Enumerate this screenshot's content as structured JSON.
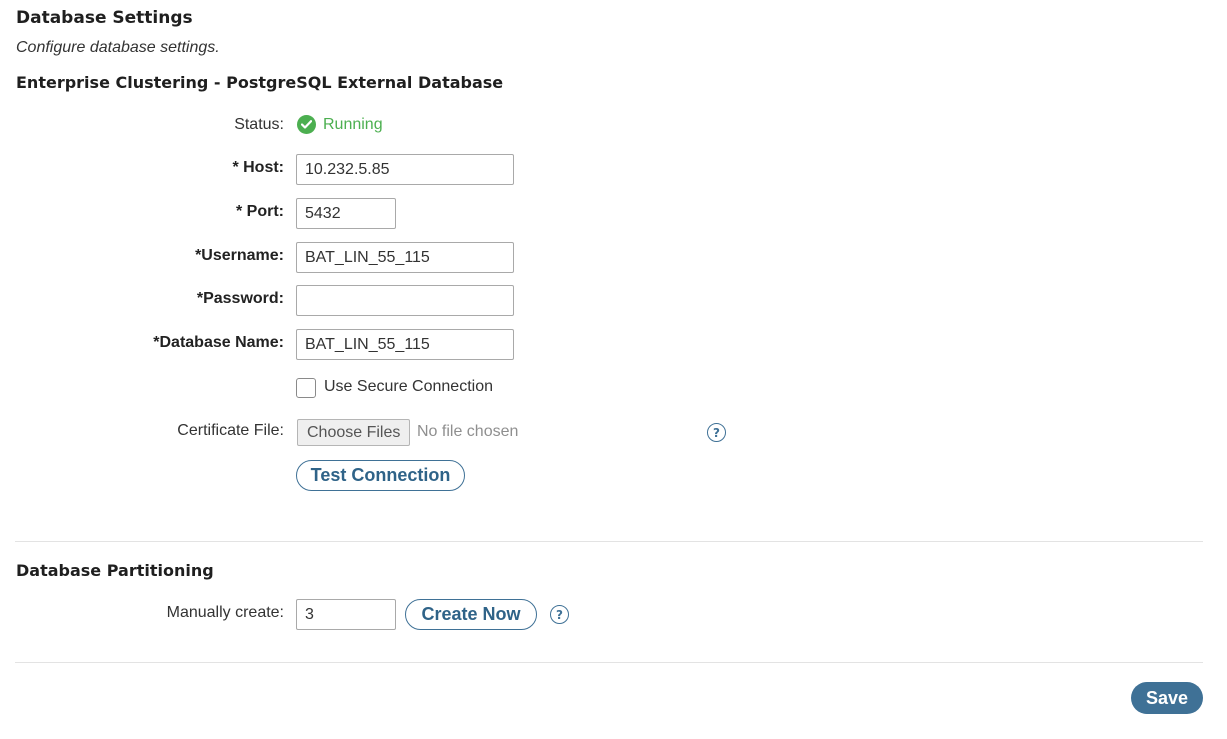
{
  "page": {
    "title": "Database Settings",
    "subtitle": "Configure database settings."
  },
  "clustering": {
    "heading": "Enterprise Clustering - PostgreSQL External Database",
    "status_label": "Status:",
    "status_value": "Running",
    "host_label": "* Host:",
    "host_value": "10.232.5.85",
    "port_label": "* Port:",
    "port_value": "5432",
    "username_label": "*Username:",
    "username_value": "BAT_LIN_55_115",
    "password_label": "*Password:",
    "password_value": "",
    "dbname_label": "*Database Name:",
    "dbname_value": "BAT_LIN_55_115",
    "secure_label": "Use Secure Connection",
    "secure_checked": false,
    "cert_label": "Certificate File:",
    "choose_files_label": "Choose Files",
    "file_status": "No file chosen",
    "help_glyph": "?",
    "test_connection_label": "Test Connection"
  },
  "partitioning": {
    "heading": "Database Partitioning",
    "manual_label": "Manually create:",
    "manual_value": "3",
    "create_now_label": "Create Now",
    "help_glyph": "?"
  },
  "footer": {
    "save_label": "Save"
  },
  "colors": {
    "accent": "#3f7196",
    "status_ok": "#4caf50",
    "divider": "#e3e3e3"
  },
  "icons": {
    "status": "check-circle-icon",
    "help": "question-circle-icon"
  }
}
